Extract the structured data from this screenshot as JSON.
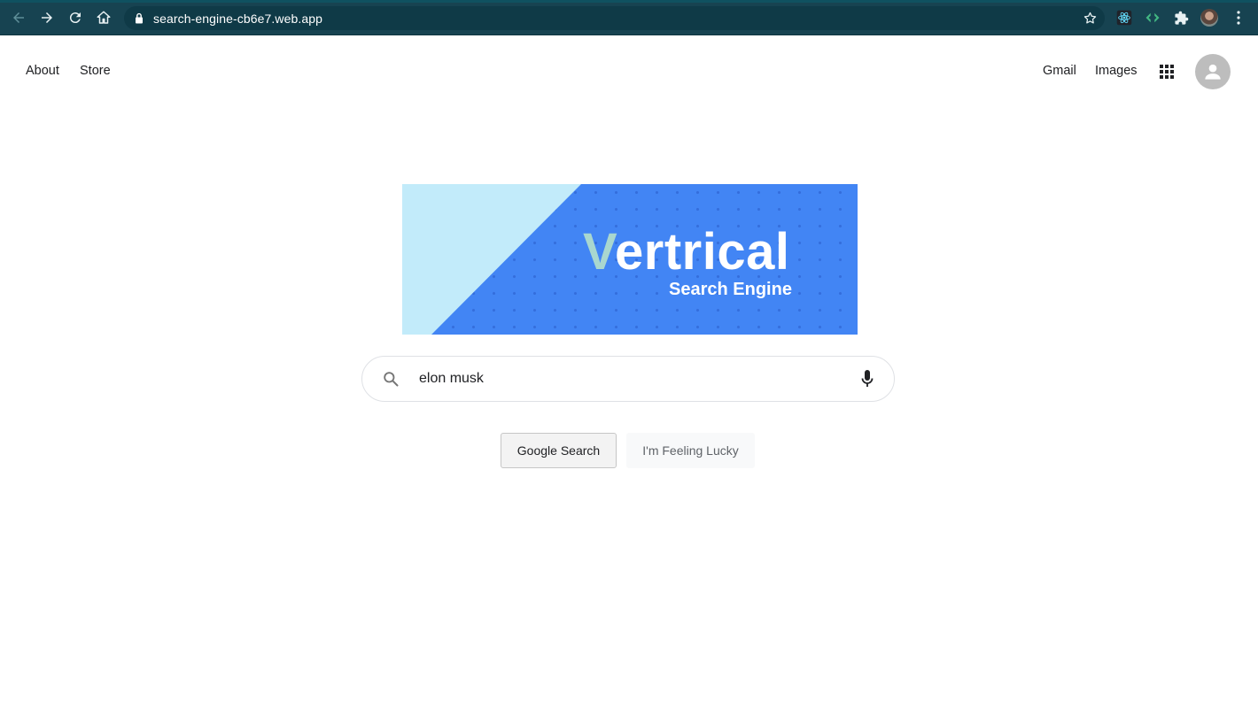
{
  "browser": {
    "url": "search-engine-cb6e7.web.app"
  },
  "header": {
    "left_links": [
      "About",
      "Store"
    ],
    "right_links": [
      "Gmail",
      "Images"
    ]
  },
  "logo": {
    "lead_letter": "V",
    "word_rest": "ertrical",
    "subtitle": "Search Engine"
  },
  "search": {
    "value": "elon musk"
  },
  "buttons": {
    "primary": "Google Search",
    "secondary": "I'm Feeling Lucky"
  },
  "colors": {
    "chrome_bg": "#174351",
    "banner_blue": "#4285f4",
    "banner_light": "#c2ebfa",
    "v_accent": "#a9d7cf"
  }
}
